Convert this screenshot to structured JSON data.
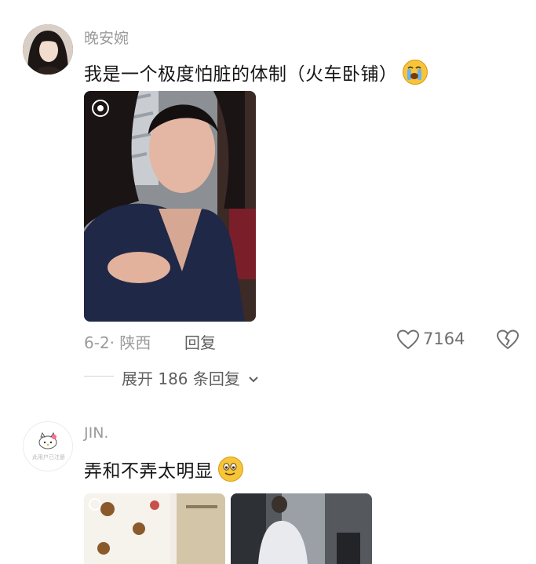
{
  "comments": [
    {
      "username": "晚安婉",
      "text": "我是一个极度怕脏的体制（火车卧铺）",
      "emoji": "crying-face-emoji",
      "meta": "6-2· 陕西",
      "reply_label": "回复",
      "like_count": "7164",
      "expand_label": "展开 186 条回复"
    },
    {
      "username": "JIN.",
      "avatar_caption": "此用户已注册",
      "text": "弄和不弄太明显",
      "emoji": "smiling-face-emoji"
    }
  ],
  "colors": {
    "username": "#9b9b9b",
    "text": "#161616",
    "meta": "#9b9b9b",
    "emoji": "#f7c53a"
  }
}
